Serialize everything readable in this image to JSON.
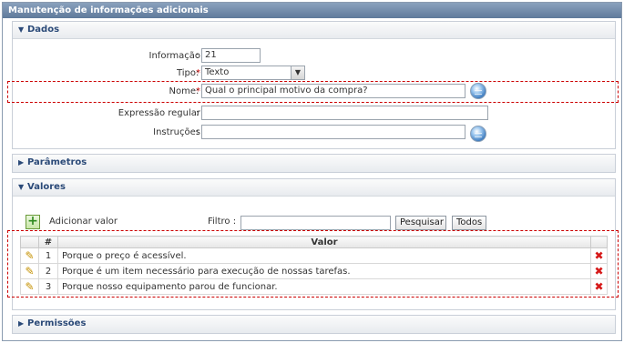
{
  "window": {
    "title": "Manutenção de informações adicionais"
  },
  "dados": {
    "header": "Dados",
    "fields": {
      "informacao": {
        "label": "Informação",
        "value": "21"
      },
      "tipo": {
        "label": "Tipo",
        "value": "Texto",
        "required_mark": "*"
      },
      "nome": {
        "label": "Nome",
        "value": "Qual o principal motivo da compra?",
        "required_mark": "*"
      },
      "expressao": {
        "label": "Expressão regular",
        "value": ""
      },
      "instrucoes": {
        "label": "Instruções",
        "value": ""
      }
    },
    "colon": ":"
  },
  "parametros": {
    "header": "Parâmetros"
  },
  "valores": {
    "header": "Valores",
    "add_label": "Adicionar valor",
    "filter_label": "Filtro",
    "filter_value": "",
    "search_button": "Pesquisar",
    "all_button": "Todos",
    "table": {
      "headers": [
        "",
        "#",
        "Valor",
        ""
      ],
      "rows": [
        {
          "num": "1",
          "valor": "Porque o preço é acessível."
        },
        {
          "num": "2",
          "valor": "Porque é um item necessário para execução de nossas tarefas."
        },
        {
          "num": "3",
          "valor": "Porque nosso equipamento parou de funcionar."
        }
      ]
    }
  },
  "permissoes": {
    "header": "Permissões"
  },
  "icons": {
    "expanded": "triangle-down-icon",
    "collapsed": "triangle-right-icon",
    "edit": "pencil-icon",
    "delete": "delete-x-icon",
    "add": "plus-icon",
    "globe": "globe-icon",
    "dropdown": "chevron-down-icon"
  },
  "colors": {
    "header_text": "#2b4a78",
    "required": "#cc0000",
    "highlight_border": "#cc0000",
    "delete": "#d61a1a"
  }
}
